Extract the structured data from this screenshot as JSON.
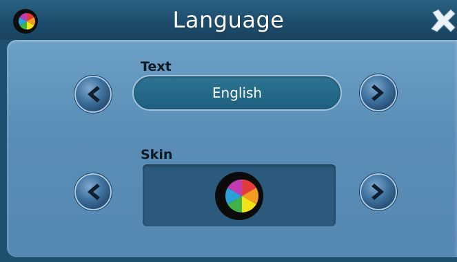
{
  "window": {
    "title": "Language"
  },
  "text_setting": {
    "label": "Text",
    "value": "English"
  },
  "skin_setting": {
    "label": "Skin"
  },
  "icons": {
    "app_logo": "color-wheel-logo-icon",
    "close": "close-icon",
    "prev": "chevron-left-icon",
    "next": "chevron-right-icon"
  },
  "colors": {
    "titlebar": "#1d4d6c",
    "panel": "#5a8db5",
    "field": "#236a89",
    "skin_box": "#2c5a7c",
    "arrow_button": "#3a6c98"
  }
}
